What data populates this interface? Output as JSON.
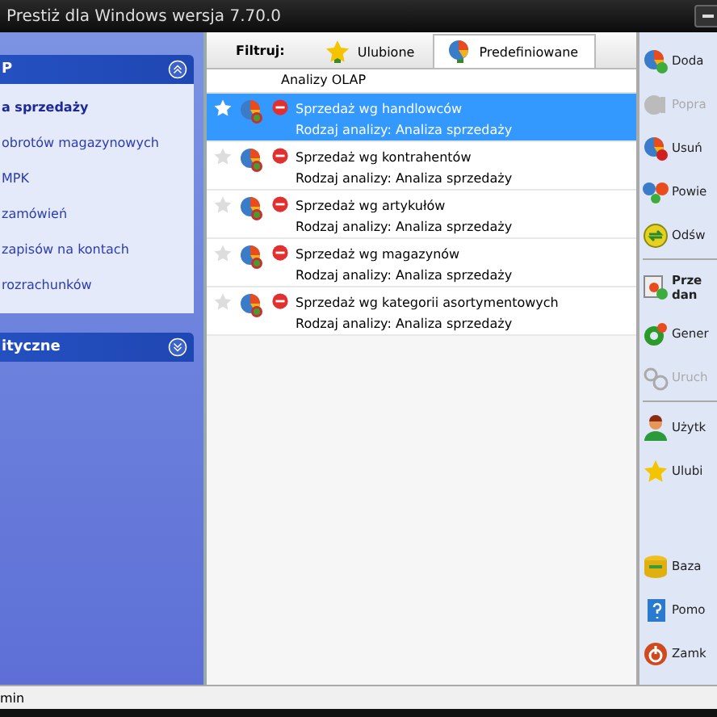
{
  "window": {
    "title": "Prestiż dla Windows wersja 7.70.0"
  },
  "sidebar": {
    "groups": [
      {
        "title": "P",
        "expanded": true,
        "items": [
          {
            "label": "a sprzedaży",
            "selected": true
          },
          {
            "label": "obrotów magazynowych",
            "selected": false
          },
          {
            "label": "MPK",
            "selected": false
          },
          {
            "label": "zamówień",
            "selected": false
          },
          {
            "label": "zapisów na kontach",
            "selected": false
          },
          {
            "label": "rozrachunków",
            "selected": false
          }
        ]
      },
      {
        "title": "ityczne",
        "expanded": false
      }
    ]
  },
  "filter": {
    "label": "Filtruj:",
    "tabs": [
      {
        "label": "Ulubione",
        "selected": false
      },
      {
        "label": "Predefiniowane",
        "selected": true
      }
    ]
  },
  "table": {
    "column_header": "Analizy OLAP",
    "rows": [
      {
        "name": "Sprzedaż wg handlowców",
        "type": "Rodzaj analizy: Analiza sprzedaży",
        "selected": true
      },
      {
        "name": "Sprzedaż wg kontrahentów",
        "type": "Rodzaj analizy: Analiza sprzedaży",
        "selected": false
      },
      {
        "name": "Sprzedaż wg artykułów",
        "type": "Rodzaj analizy: Analiza sprzedaży",
        "selected": false
      },
      {
        "name": "Sprzedaż wg magazynów",
        "type": "Rodzaj analizy: Analiza sprzedaży",
        "selected": false
      },
      {
        "name": "Sprzedaż wg kategorii asortymentowych",
        "type": "Rodzaj analizy: Analiza sprzedaży",
        "selected": false
      }
    ]
  },
  "actions": [
    {
      "kind": "add",
      "label": "Doda",
      "disabled": false
    },
    {
      "kind": "edit",
      "label": "Popra",
      "disabled": true
    },
    {
      "kind": "delete",
      "label": "Usuń",
      "disabled": false
    },
    {
      "kind": "copy",
      "label": "Powie",
      "disabled": false
    },
    {
      "kind": "refresh",
      "label": "Odśw",
      "disabled": false
    },
    {
      "kind": "separator"
    },
    {
      "kind": "data",
      "label": "Prze\ndan",
      "disabled": false
    },
    {
      "kind": "generate",
      "label": "Gener",
      "disabled": false
    },
    {
      "kind": "run",
      "label": "Uruch",
      "disabled": true
    },
    {
      "kind": "separator"
    },
    {
      "kind": "user",
      "label": "Użytk",
      "disabled": false
    },
    {
      "kind": "favorite",
      "label": "Ulubi",
      "disabled": false
    },
    {
      "kind": "spacer"
    },
    {
      "kind": "database",
      "label": "Baza",
      "disabled": false
    },
    {
      "kind": "help",
      "label": "Pomo",
      "disabled": false
    },
    {
      "kind": "close",
      "label": "Zamk",
      "disabled": false
    }
  ],
  "status_bar": {
    "text": "min"
  }
}
